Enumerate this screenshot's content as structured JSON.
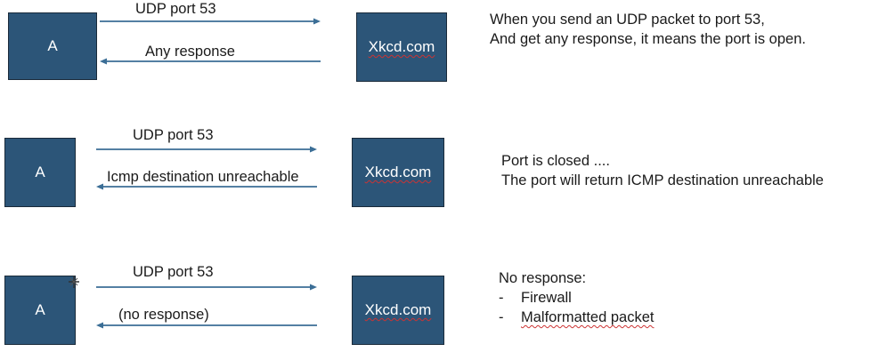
{
  "scenes": [
    {
      "client": "A",
      "server": "Xkcd.com",
      "request": "UDP port 53",
      "response": "Any response",
      "note_lines": [
        "When you send an UDP packet to port 53,",
        "And get any response, it means the port is open."
      ]
    },
    {
      "client": "A",
      "server": "Xkcd.com",
      "request": "UDP port 53",
      "response": "Icmp destination unreachable",
      "note_lines": [
        "Port is closed ....",
        "The port will return ICMP destination unreachable"
      ]
    },
    {
      "client": "A",
      "server": "Xkcd.com",
      "request": "UDP port 53",
      "response": "(no response)",
      "note_title": "No response:",
      "note_items": [
        "Firewall",
        "Malformatted packet"
      ]
    }
  ],
  "colors": {
    "box_fill": "#2c5578",
    "arrow": "#3b6e96",
    "spell_squiggle": "#cc3333"
  }
}
